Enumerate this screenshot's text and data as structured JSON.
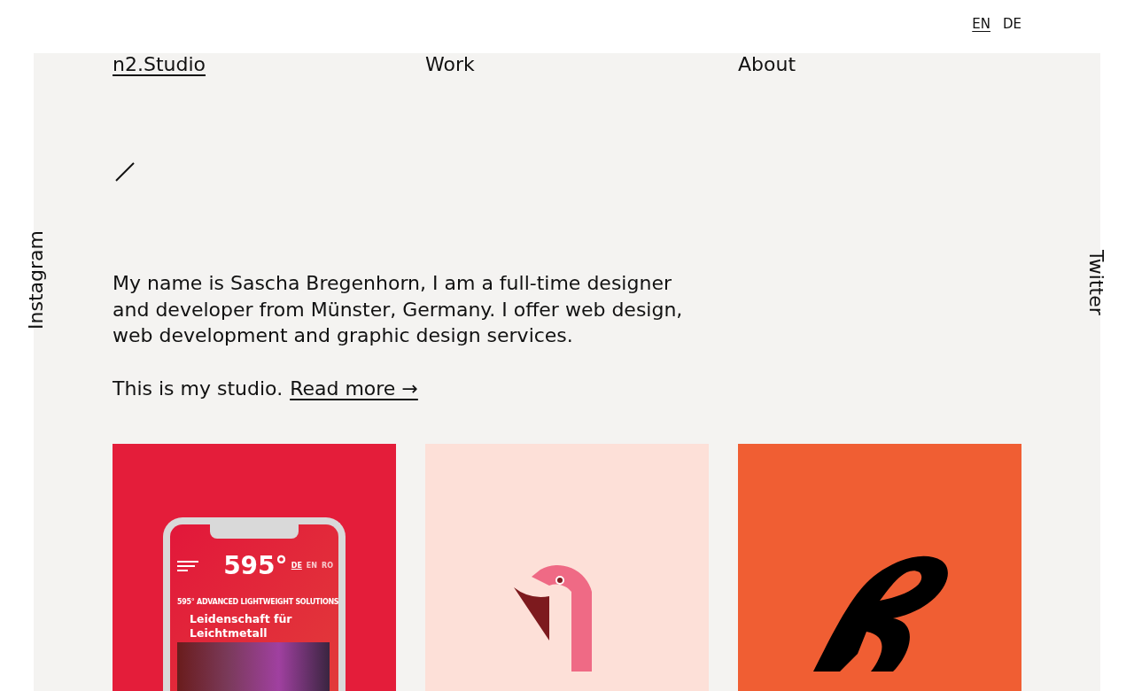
{
  "language_switcher": [
    {
      "label": "EN",
      "selected": true
    },
    {
      "label": "DE",
      "selected": false
    }
  ],
  "nav": [
    {
      "label": "n2.Studio",
      "selected": true
    },
    {
      "label": "Work",
      "selected": false
    },
    {
      "label": "About",
      "selected": false
    }
  ],
  "social_links": [
    {
      "label": "Instagram"
    },
    {
      "label": "Twitter"
    }
  ],
  "intro": {
    "text": "My name is Sascha Bregenhorn, I am a full-time designer and developer from Münster, Germany. I offer web design, web development and graphic design services.",
    "studio_text": "This is my studio.",
    "link": "Read more →"
  },
  "projects": [
    {
      "kind": "phone",
      "color": "#e41d3a",
      "phone": {
        "logo": "595°",
        "languages": [
          {
            "label": "DE",
            "selected": true
          },
          {
            "label": "EN",
            "selected": false
          },
          {
            "label": "RO",
            "selected": false
          }
        ],
        "tagline": "595° ADVANCED LIGHTWEIGHT SOLUTIONS",
        "headline": "Leidenschaft für Leichtmetall"
      }
    },
    {
      "kind": "flamingo",
      "color": "#fde0d8"
    },
    {
      "kind": "lettering",
      "color": "#f05e33"
    }
  ]
}
